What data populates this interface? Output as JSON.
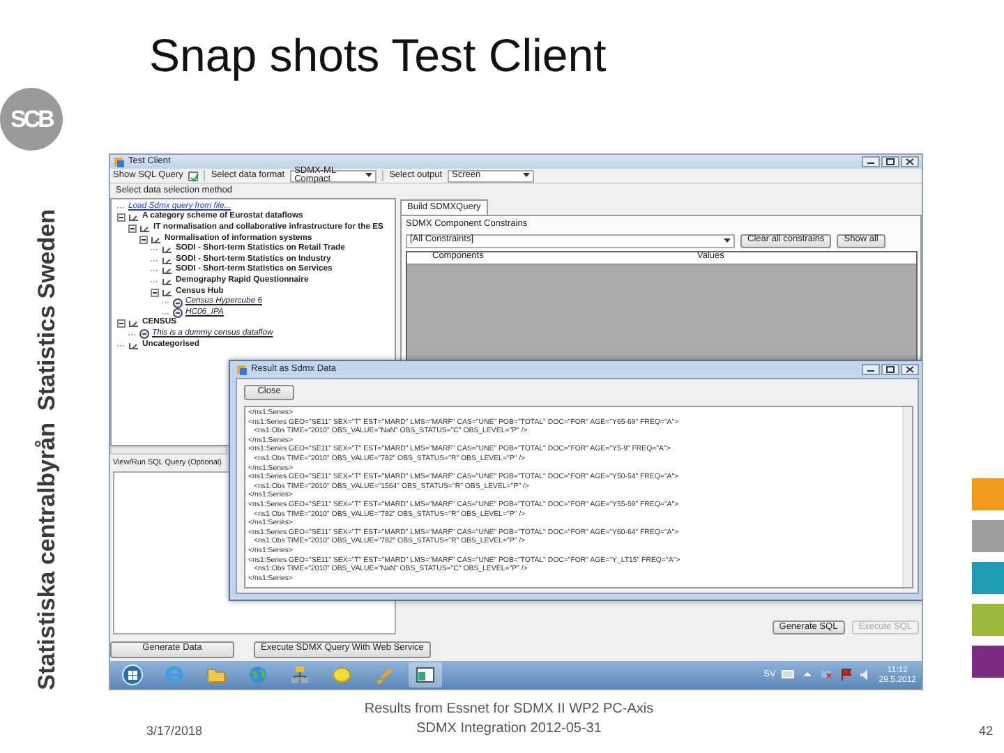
{
  "slide": {
    "title": "Snap shots Test Client",
    "logo": "SCB",
    "side_texts": [
      "Statistics Sweden",
      "Statistiska centralbyrån"
    ],
    "color_tabs": [
      {
        "color": "#f39a1e"
      },
      {
        "color": "#9d9d9d"
      },
      {
        "color": "#1f9bb2"
      },
      {
        "color": "#9cba3a"
      },
      {
        "color": "#7c2c82"
      }
    ]
  },
  "window": {
    "title": "Test Client",
    "toolbar": {
      "show_sql_label": "Show SQL Query",
      "show_sql_checked": true,
      "format_label": "Select data format",
      "format_value": "SDMX-ML Compact",
      "output_label": "Select output",
      "output_value": "Screen"
    },
    "selection_label": "Select data selection method",
    "tree": [
      {
        "kind": "action",
        "label": "Load Sdmx query from file..."
      },
      {
        "kind": "category",
        "label": "A category scheme of Eurostat dataflows",
        "expanded": true,
        "children": [
          {
            "kind": "category",
            "label": "IT normalisation and collaborative infrastructure for the ES",
            "expanded": true,
            "children": [
              {
                "kind": "category",
                "label": "Normalisation of information systems",
                "expanded": true,
                "children": [
                  {
                    "kind": "category",
                    "label": "SODI - Short-term Statistics on Retail Trade"
                  },
                  {
                    "kind": "category",
                    "label": "SODI - Short-term Statistics on Industry"
                  },
                  {
                    "kind": "category",
                    "label": "SODI - Short-term Statistics on Services"
                  },
                  {
                    "kind": "category",
                    "label": "Demography Rapid Questionnaire"
                  },
                  {
                    "kind": "category",
                    "label": "Census Hub",
                    "expanded": true,
                    "children": [
                      {
                        "kind": "dataflow",
                        "label": "Census Hypercube 6"
                      },
                      {
                        "kind": "dataflow",
                        "label": "HC06_IPA"
                      }
                    ]
                  }
                ]
              }
            ]
          }
        ]
      },
      {
        "kind": "category",
        "label": "CENSUS",
        "expanded": true,
        "children": [
          {
            "kind": "dataflow",
            "label": "This is a dummy census dataflow"
          }
        ]
      },
      {
        "kind": "category",
        "label": "Uncategorised"
      }
    ],
    "tabs": [
      {
        "label": "Build SDMXQuery",
        "selected": true
      }
    ],
    "constraints": {
      "label": "SDMX Component Constrains",
      "dropdown": "[All Constraints]",
      "buttons": [
        "Clear all constrains",
        "Show all"
      ]
    },
    "grid_columns": [
      "Components",
      "Values"
    ],
    "sql_label": "View/Run SQL Query (Optional)",
    "sql_buttons": [
      {
        "label": "Generate SQL",
        "disabled": false
      },
      {
        "label": "Execute SQL",
        "disabled": true
      }
    ],
    "bottom_buttons": [
      "Generate Data",
      "Execute SDMX Query With Web Service"
    ]
  },
  "dialog": {
    "title": "Result as Sdmx Data",
    "close_button": "Close",
    "lines": [
      {
        "kind": "end",
        "text": "</ns1:Series>"
      },
      {
        "kind": "series",
        "text": "<ns1:Series GEO=\"SE11\" SEX=\"T\" EST=\"MARD\" LMS=\"MARF\" CAS=\"UNE\" POB=\"TOTAL\" DOC=\"FOR\" AGE=\"Y65-69\" FREQ=\"A\">"
      },
      {
        "kind": "obs",
        "text": "<ns1:Obs TIME=\"2010\" OBS_VALUE=\"NaN\" OBS_STATUS=\"C\" OBS_LEVEL=\"P\" />"
      },
      {
        "kind": "end",
        "text": "</ns1:Series>"
      },
      {
        "kind": "series",
        "text": "<ns1:Series GEO=\"SE11\" SEX=\"T\" EST=\"MARD\" LMS=\"MARF\" CAS=\"UNE\" POB=\"TOTAL\" DOC=\"FOR\" AGE=\"Y5-9\" FREQ=\"A\">"
      },
      {
        "kind": "obs",
        "text": "<ns1:Obs TIME=\"2010\" OBS_VALUE=\"782\" OBS_STATUS=\"R\" OBS_LEVEL=\"P\" />"
      },
      {
        "kind": "end",
        "text": "</ns1:Series>"
      },
      {
        "kind": "series",
        "text": "<ns1:Series GEO=\"SE11\" SEX=\"T\" EST=\"MARD\" LMS=\"MARF\" CAS=\"UNE\" POB=\"TOTAL\" DOC=\"FOR\" AGE=\"Y50-54\" FREQ=\"A\">"
      },
      {
        "kind": "obs",
        "text": "<ns1:Obs TIME=\"2010\" OBS_VALUE=\"1564\" OBS_STATUS=\"R\" OBS_LEVEL=\"P\" />"
      },
      {
        "kind": "end",
        "text": "</ns1:Series>"
      },
      {
        "kind": "series",
        "text": "<ns1:Series GEO=\"SE11\" SEX=\"T\" EST=\"MARD\" LMS=\"MARF\" CAS=\"UNE\" POB=\"TOTAL\" DOC=\"FOR\" AGE=\"Y55-59\" FREQ=\"A\">"
      },
      {
        "kind": "obs",
        "text": "<ns1:Obs TIME=\"2010\" OBS_VALUE=\"782\" OBS_STATUS=\"R\" OBS_LEVEL=\"P\" />"
      },
      {
        "kind": "end",
        "text": "</ns1:Series>"
      },
      {
        "kind": "series",
        "text": "<ns1:Series GEO=\"SE11\" SEX=\"T\" EST=\"MARD\" LMS=\"MARF\" CAS=\"UNE\" POB=\"TOTAL\" DOC=\"FOR\" AGE=\"Y60-64\" FREQ=\"A\">"
      },
      {
        "kind": "obs",
        "text": "<ns1:Obs TIME=\"2010\" OBS_VALUE=\"782\" OBS_STATUS=\"R\" OBS_LEVEL=\"P\" />"
      },
      {
        "kind": "end",
        "text": "</ns1:Series>"
      },
      {
        "kind": "series",
        "text": "<ns1:Series GEO=\"SE11\" SEX=\"T\" EST=\"MARD\" LMS=\"MARF\" CAS=\"UNE\" POB=\"TOTAL\" DOC=\"FOR\" AGE=\"Y_LT15\" FREQ=\"A\">"
      },
      {
        "kind": "obs",
        "text": "<ns1:Obs TIME=\"2010\" OBS_VALUE=\"NaN\" OBS_STATUS=\"C\" OBS_LEVEL=\"P\" />"
      },
      {
        "kind": "end",
        "text": "</ns1:Series>"
      }
    ]
  },
  "taskbar": {
    "language": "SV",
    "time": "11:12",
    "date": "29.5.2012"
  },
  "footer": {
    "date": "3/17/2018",
    "caption": "Results from Essnet for SDMX II WP2 PC-Axis SDMX Integration 2012-05-31",
    "page": "42"
  }
}
